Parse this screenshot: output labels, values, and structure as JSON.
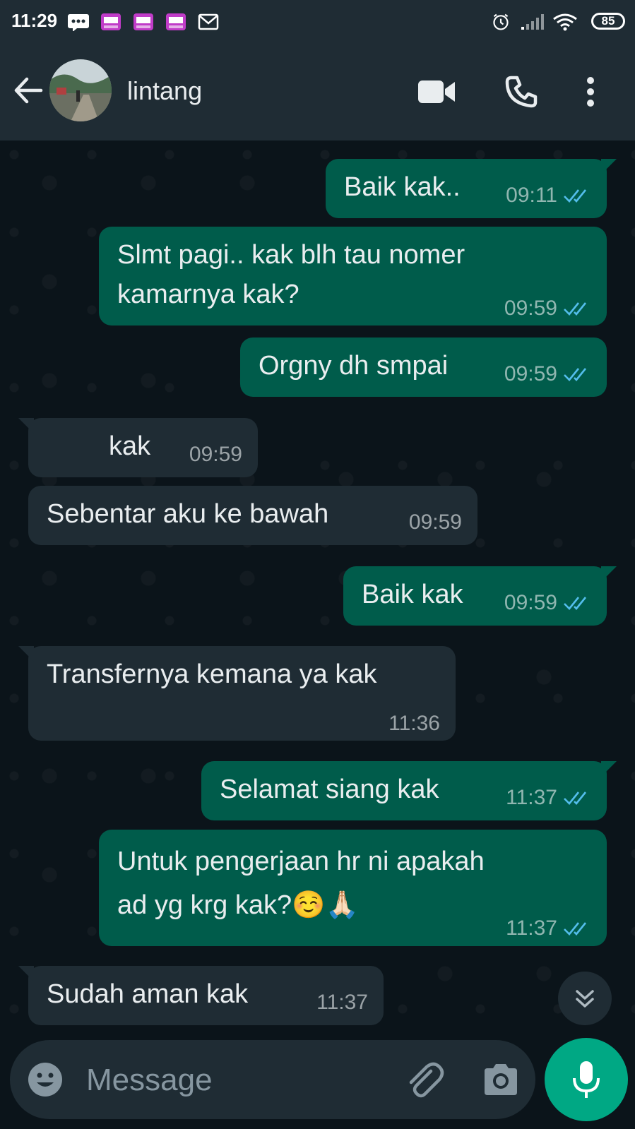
{
  "status_bar": {
    "time": "11:29",
    "battery": "85"
  },
  "header": {
    "contact_name": "lintang"
  },
  "messages": [
    {
      "dir": "out",
      "text": "Baik kak..",
      "time": "09:11"
    },
    {
      "dir": "out",
      "text": "Slmt pagi.. kak blh tau nomer\nkamarnya kak?",
      "time": "09:59"
    },
    {
      "dir": "out",
      "text": "Orgny dh smpai",
      "time": "09:59"
    },
    {
      "dir": "in",
      "text": "kak",
      "time": "09:59"
    },
    {
      "dir": "in",
      "text": "Sebentar aku ke bawah",
      "time": "09:59"
    },
    {
      "dir": "out",
      "text": "Baik kak",
      "time": "09:59"
    },
    {
      "dir": "in",
      "text": "Transfernya kemana ya kak",
      "time": "11:36"
    },
    {
      "dir": "out",
      "text": "Selamat siang kak",
      "time": "11:37"
    },
    {
      "dir": "out",
      "text": "Untuk pengerjaan hr ni apakah\nad yg krg kak?☺️🙏🏻",
      "time": "11:37"
    },
    {
      "dir": "in",
      "text": "Sudah aman kak",
      "time": "11:37"
    }
  ],
  "composer": {
    "placeholder": "Message"
  },
  "colors": {
    "header": "#1f2c34",
    "background": "#0b141a",
    "outgoing_bubble": "#005c4b",
    "incoming_bubble": "#1f2c34",
    "accent": "#00a884",
    "read_tick": "#53bdeb"
  },
  "icons": [
    "notification-dots-icon",
    "app-badge-icon",
    "mail-icon",
    "alarm-icon",
    "signal-icon",
    "wifi-icon",
    "battery-icon",
    "back-arrow-icon",
    "video-call-icon",
    "phone-icon",
    "more-vert-icon",
    "scroll-down-icon",
    "emoji-icon",
    "attach-icon",
    "camera-icon",
    "mic-icon"
  ]
}
